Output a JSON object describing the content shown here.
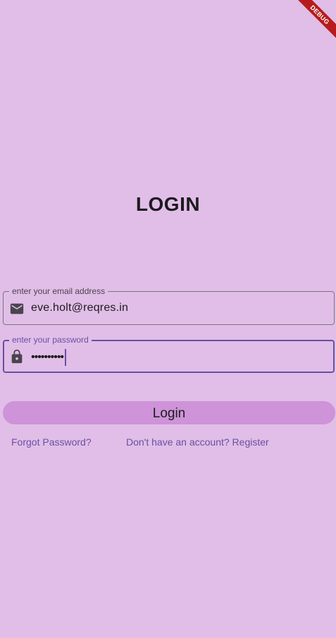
{
  "debug_banner": "DEBUG",
  "title": "LOGIN",
  "email_field": {
    "label": "enter your email address",
    "value": "eve.holt@reqres.in",
    "icon": "email-icon"
  },
  "password_field": {
    "label": "enter your password",
    "value": "••••••••••",
    "icon": "lock-icon"
  },
  "login_button": "Login",
  "links": {
    "forgot": "Forgot Password?",
    "register": "Don't have an account? Register"
  },
  "colors": {
    "background": "#e1bee7",
    "button": "#ce93d8",
    "accent": "#6750a4",
    "debug": "#b71c1c"
  }
}
